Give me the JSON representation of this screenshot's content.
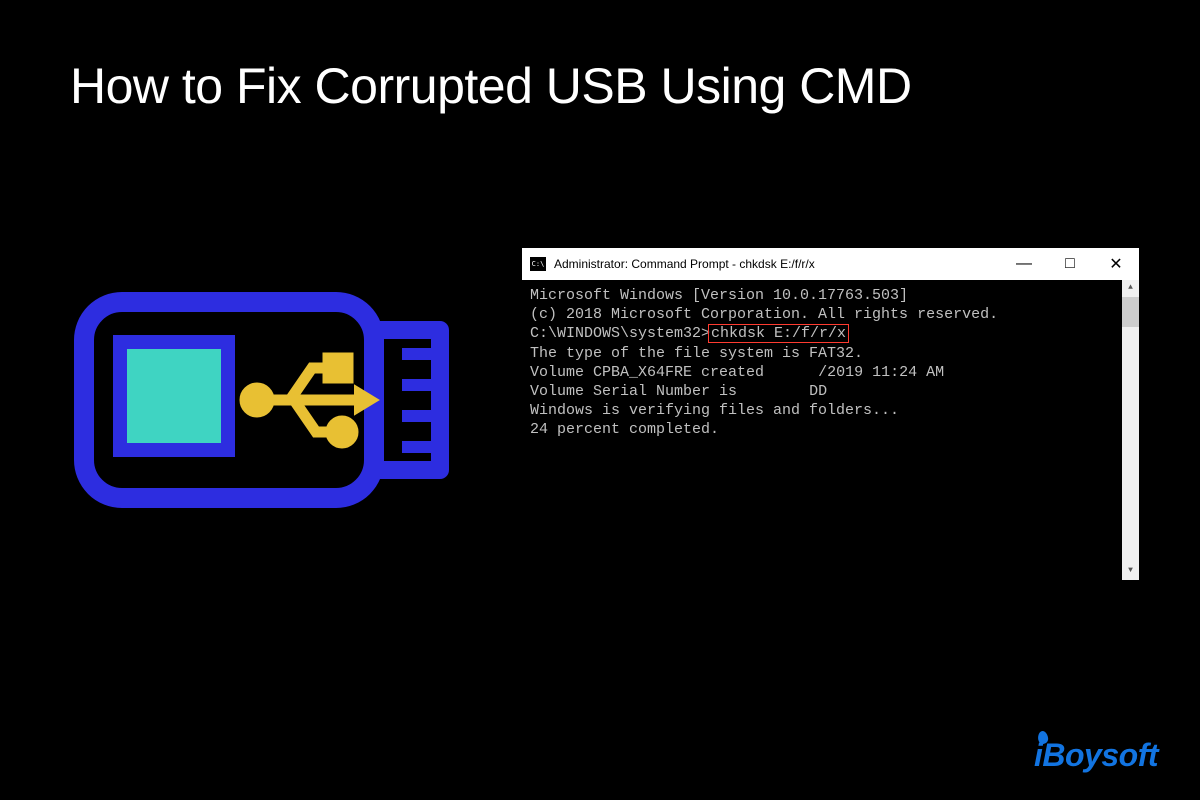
{
  "title": "How to Fix Corrupted USB Using CMD",
  "cmd": {
    "window_title": "Administrator: Command Prompt - chkdsk  E:/f/r/x",
    "icon_label": "C:\\",
    "lines": {
      "l0": "Microsoft Windows [Version 10.0.17763.503]",
      "l1": "(c) 2018 Microsoft Corporation. All rights reserved.",
      "blank": "",
      "prompt": "C:\\WINDOWS\\system32>",
      "command": "chkdsk E:/f/r/x",
      "l2": "The type of the file system is FAT32.",
      "l3a": "Volume CPBA_X64FRE created ",
      "l3r": "     ",
      "l3b": "/2019 11:24 AM",
      "l4a": "Volume Serial Number is ",
      "l4r": "       ",
      "l4b": "DD",
      "l5": "Windows is verifying files and folders...",
      "l6": "24 percent completed."
    },
    "controls": {
      "minimize": "—",
      "maximize": "□",
      "close": "✕"
    },
    "scroll": {
      "up": "▲",
      "down": "▼"
    }
  },
  "brand": {
    "text_pre": "iBoy",
    "text_post": "soft"
  },
  "colors": {
    "usb_outline": "#2d2de0",
    "usb_fill": "#3fd4c2",
    "usb_symbol": "#e8c033",
    "highlight_border": "#ff3b30",
    "brand": "#1274e1"
  }
}
